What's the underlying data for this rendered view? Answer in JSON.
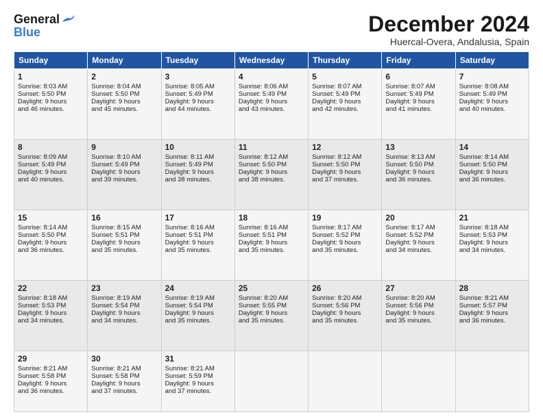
{
  "header": {
    "logo_line1": "General",
    "logo_line2": "Blue",
    "month": "December 2024",
    "location": "Huercal-Overa, Andalusia, Spain"
  },
  "weekdays": [
    "Sunday",
    "Monday",
    "Tuesday",
    "Wednesday",
    "Thursday",
    "Friday",
    "Saturday"
  ],
  "weeks": [
    [
      {
        "day": "1",
        "lines": [
          "Sunrise: 8:03 AM",
          "Sunset: 5:50 PM",
          "Daylight: 9 hours",
          "and 46 minutes."
        ]
      },
      {
        "day": "2",
        "lines": [
          "Sunrise: 8:04 AM",
          "Sunset: 5:50 PM",
          "Daylight: 9 hours",
          "and 45 minutes."
        ]
      },
      {
        "day": "3",
        "lines": [
          "Sunrise: 8:05 AM",
          "Sunset: 5:49 PM",
          "Daylight: 9 hours",
          "and 44 minutes."
        ]
      },
      {
        "day": "4",
        "lines": [
          "Sunrise: 8:06 AM",
          "Sunset: 5:49 PM",
          "Daylight: 9 hours",
          "and 43 minutes."
        ]
      },
      {
        "day": "5",
        "lines": [
          "Sunrise: 8:07 AM",
          "Sunset: 5:49 PM",
          "Daylight: 9 hours",
          "and 42 minutes."
        ]
      },
      {
        "day": "6",
        "lines": [
          "Sunrise: 8:07 AM",
          "Sunset: 5:49 PM",
          "Daylight: 9 hours",
          "and 41 minutes."
        ]
      },
      {
        "day": "7",
        "lines": [
          "Sunrise: 8:08 AM",
          "Sunset: 5:49 PM",
          "Daylight: 9 hours",
          "and 40 minutes."
        ]
      }
    ],
    [
      {
        "day": "8",
        "lines": [
          "Sunrise: 8:09 AM",
          "Sunset: 5:49 PM",
          "Daylight: 9 hours",
          "and 40 minutes."
        ]
      },
      {
        "day": "9",
        "lines": [
          "Sunrise: 8:10 AM",
          "Sunset: 5:49 PM",
          "Daylight: 9 hours",
          "and 39 minutes."
        ]
      },
      {
        "day": "10",
        "lines": [
          "Sunrise: 8:11 AM",
          "Sunset: 5:49 PM",
          "Daylight: 9 hours",
          "and 38 minutes."
        ]
      },
      {
        "day": "11",
        "lines": [
          "Sunrise: 8:12 AM",
          "Sunset: 5:50 PM",
          "Daylight: 9 hours",
          "and 38 minutes."
        ]
      },
      {
        "day": "12",
        "lines": [
          "Sunrise: 8:12 AM",
          "Sunset: 5:50 PM",
          "Daylight: 9 hours",
          "and 37 minutes."
        ]
      },
      {
        "day": "13",
        "lines": [
          "Sunrise: 8:13 AM",
          "Sunset: 5:50 PM",
          "Daylight: 9 hours",
          "and 36 minutes."
        ]
      },
      {
        "day": "14",
        "lines": [
          "Sunrise: 8:14 AM",
          "Sunset: 5:50 PM",
          "Daylight: 9 hours",
          "and 36 minutes."
        ]
      }
    ],
    [
      {
        "day": "15",
        "lines": [
          "Sunrise: 8:14 AM",
          "Sunset: 5:50 PM",
          "Daylight: 9 hours",
          "and 36 minutes."
        ]
      },
      {
        "day": "16",
        "lines": [
          "Sunrise: 8:15 AM",
          "Sunset: 5:51 PM",
          "Daylight: 9 hours",
          "and 35 minutes."
        ]
      },
      {
        "day": "17",
        "lines": [
          "Sunrise: 8:16 AM",
          "Sunset: 5:51 PM",
          "Daylight: 9 hours",
          "and 35 minutes."
        ]
      },
      {
        "day": "18",
        "lines": [
          "Sunrise: 8:16 AM",
          "Sunset: 5:51 PM",
          "Daylight: 9 hours",
          "and 35 minutes."
        ]
      },
      {
        "day": "19",
        "lines": [
          "Sunrise: 8:17 AM",
          "Sunset: 5:52 PM",
          "Daylight: 9 hours",
          "and 35 minutes."
        ]
      },
      {
        "day": "20",
        "lines": [
          "Sunrise: 8:17 AM",
          "Sunset: 5:52 PM",
          "Daylight: 9 hours",
          "and 34 minutes."
        ]
      },
      {
        "day": "21",
        "lines": [
          "Sunrise: 8:18 AM",
          "Sunset: 5:53 PM",
          "Daylight: 9 hours",
          "and 34 minutes."
        ]
      }
    ],
    [
      {
        "day": "22",
        "lines": [
          "Sunrise: 8:18 AM",
          "Sunset: 5:53 PM",
          "Daylight: 9 hours",
          "and 34 minutes."
        ]
      },
      {
        "day": "23",
        "lines": [
          "Sunrise: 8:19 AM",
          "Sunset: 5:54 PM",
          "Daylight: 9 hours",
          "and 34 minutes."
        ]
      },
      {
        "day": "24",
        "lines": [
          "Sunrise: 8:19 AM",
          "Sunset: 5:54 PM",
          "Daylight: 9 hours",
          "and 35 minutes."
        ]
      },
      {
        "day": "25",
        "lines": [
          "Sunrise: 8:20 AM",
          "Sunset: 5:55 PM",
          "Daylight: 9 hours",
          "and 35 minutes."
        ]
      },
      {
        "day": "26",
        "lines": [
          "Sunrise: 8:20 AM",
          "Sunset: 5:56 PM",
          "Daylight: 9 hours",
          "and 35 minutes."
        ]
      },
      {
        "day": "27",
        "lines": [
          "Sunrise: 8:20 AM",
          "Sunset: 5:56 PM",
          "Daylight: 9 hours",
          "and 35 minutes."
        ]
      },
      {
        "day": "28",
        "lines": [
          "Sunrise: 8:21 AM",
          "Sunset: 5:57 PM",
          "Daylight: 9 hours",
          "and 36 minutes."
        ]
      }
    ],
    [
      {
        "day": "29",
        "lines": [
          "Sunrise: 8:21 AM",
          "Sunset: 5:58 PM",
          "Daylight: 9 hours",
          "and 36 minutes."
        ]
      },
      {
        "day": "30",
        "lines": [
          "Sunrise: 8:21 AM",
          "Sunset: 5:58 PM",
          "Daylight: 9 hours",
          "and 37 minutes."
        ]
      },
      {
        "day": "31",
        "lines": [
          "Sunrise: 8:21 AM",
          "Sunset: 5:59 PM",
          "Daylight: 9 hours",
          "and 37 minutes."
        ]
      },
      {
        "day": "",
        "lines": []
      },
      {
        "day": "",
        "lines": []
      },
      {
        "day": "",
        "lines": []
      },
      {
        "day": "",
        "lines": []
      }
    ]
  ]
}
